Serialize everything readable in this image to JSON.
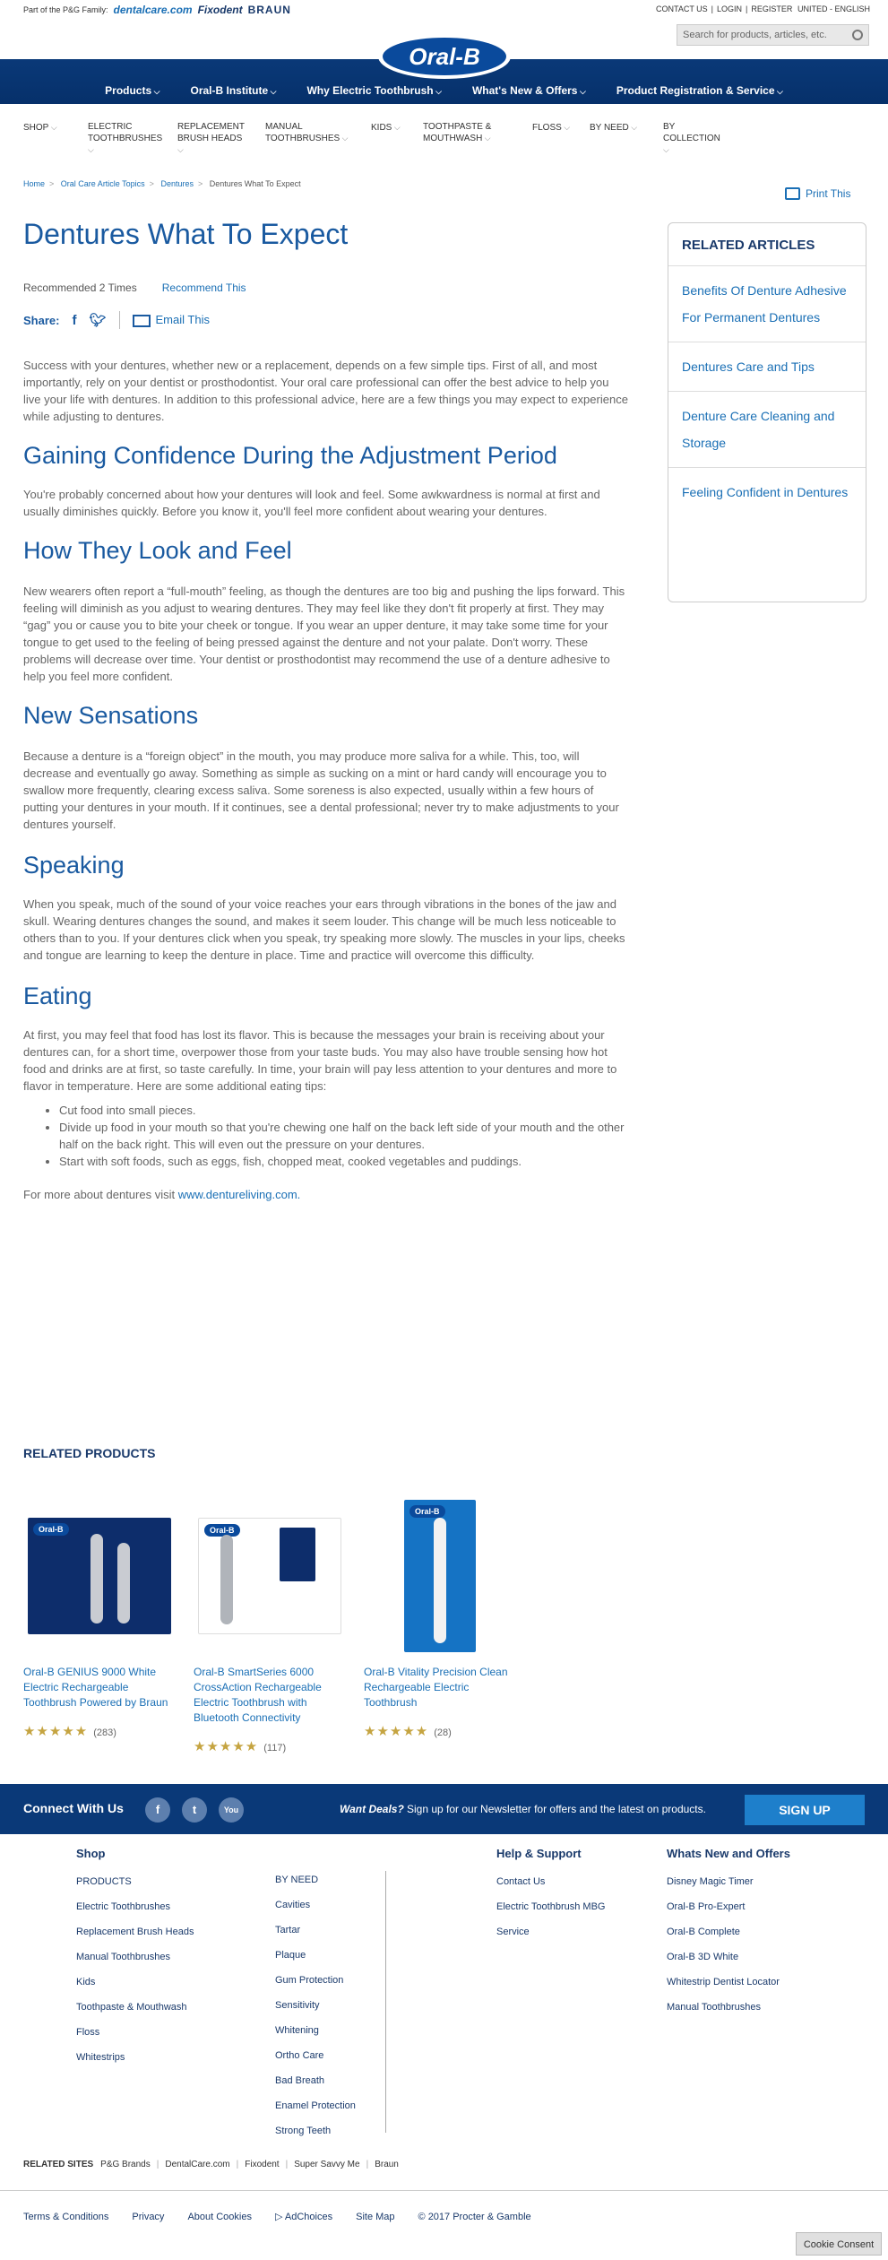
{
  "topbar": {
    "family_label": "Part of the P&G Family:",
    "brands": [
      "dentalcare.com",
      "Fixodent",
      "BRAUN"
    ],
    "contact": "CONTACT US",
    "login": "LOGIN",
    "register": "REGISTER",
    "country": "UNITED - ENGLISH"
  },
  "search": {
    "placeholder": "Search for products, articles, etc."
  },
  "logo": "Oral-B",
  "mainnav": [
    "Products",
    "Oral-B Institute",
    "Why Electric Toothbrush",
    "What's New & Offers",
    "Product Registration & Service"
  ],
  "subnav": [
    "SHOP",
    "ELECTRIC TOOTHBRUSHES",
    "REPLACEMENT BRUSH HEADS",
    "MANUAL TOOTHBRUSHES",
    "KIDS",
    "TOOTHPASTE & MOUTHWASH",
    "FLOSS",
    "BY NEED",
    "BY COLLECTION"
  ],
  "breadcrumb": [
    "Home",
    "Oral Care Article Topics",
    "Dentures",
    "Dentures What To Expect"
  ],
  "print_label": "Print This",
  "title": "Dentures What To Expect",
  "recommended": "Recommended 2 Times",
  "recommend_link": "Recommend This",
  "share_label": "Share:",
  "email_label": "Email This",
  "article": {
    "intro": "Success with your dentures, whether new or a replacement, depends on a few simple tips. First of all, and most importantly, rely on your dentist or prosthodontist. Your oral care professional can offer the best advice to help you live your life with dentures. In addition to this professional advice, here are a few things you may expect to experience while adjusting to dentures.",
    "h_conf": "Gaining Confidence During the Adjustment Period",
    "p_conf": "You're probably concerned about how your dentures will look and feel. Some awkwardness is normal at first and usually diminishes quickly. Before you know it, you'll feel more confident about wearing your dentures.",
    "h_look": "How They Look and Feel",
    "p_look": "New wearers often report a “full-mouth” feeling, as though the dentures are too big and pushing the lips forward. This feeling will diminish as you adjust to wearing dentures. They may feel like they don't fit properly at first. They may “gag” you or cause you to bite your cheek or tongue. If you wear an upper denture, it may take some time for your tongue to get used to the feeling of being pressed against the denture and not your palate. Don't worry. These problems will decrease over time. Your dentist or prosthodontist may recommend the use of a denture adhesive to help you feel more confident.",
    "h_sens": "New Sensations",
    "p_sens": "Because a denture is a “foreign object” in the mouth, you may produce more saliva for a while. This, too, will decrease and eventually go away. Something as simple as sucking on a mint or hard candy will encourage you to swallow more frequently, clearing excess saliva. Some soreness is also expected, usually within a few hours of putting your dentures in your mouth. If it continues, see a dental professional; never try to make adjustments to your dentures yourself.",
    "h_speak": "Speaking",
    "p_speak": "When you speak, much of the sound of your voice reaches your ears through vibrations in the bones of the jaw and skull. Wearing dentures changes the sound, and makes it seem louder. This change will be much less noticeable to others than to you. If your dentures click when you speak, try speaking more slowly. The muscles in your lips, cheeks and tongue are learning to keep the denture in place. Time and practice will overcome this difficulty.",
    "h_eat": "Eating",
    "p_eat": "At first, you may feel that food has lost its flavor. This is because the messages your brain is receiving about your dentures can, for a short time, overpower those from your taste buds. You may also have trouble sensing how hot food and drinks are at first, so taste carefully. In time, your brain will pay less attention to your dentures and more to flavor in temperature. Here are some additional eating tips:",
    "tips": [
      "Cut food into small pieces.",
      "Divide up food in your mouth so that you're chewing one half on the back left side of your mouth and the other half on the back right. This will even out the pressure on your dentures.",
      "Start with soft foods, such as eggs, fish, chopped meat, cooked vegetables and puddings."
    ],
    "more_prefix": "For more about dentures visit ",
    "more_link": "www.dentureliving.com."
  },
  "sidebar": {
    "heading": "RELATED ARTICLES",
    "items": [
      "Benefits Of Denture Adhesive For Permanent Dentures",
      "Dentures Care and Tips",
      "Denture Care Cleaning and Storage",
      "Feeling Confident in Dentures"
    ]
  },
  "related_products": {
    "heading": "RELATED PRODUCTS",
    "items": [
      {
        "name": "Oral-B GENIUS 9000 White Electric Rechargeable Toothbrush Powered by Braun",
        "rating": 5,
        "stars": "★★★★★",
        "count": "(283)"
      },
      {
        "name": "Oral-B SmartSeries 6000 CrossAction Rechargeable Electric Toothbrush with Bluetooth Connectivity",
        "rating": 5,
        "stars": "★★★★★",
        "count": "(117)"
      },
      {
        "name": "Oral-B Vitality Precision Clean Rechargeable Electric Toothbrush",
        "rating": 4.5,
        "stars": "★★★★★",
        "count": "(28)"
      }
    ]
  },
  "connect": {
    "label": "Connect With Us",
    "social": [
      "f",
      "t",
      "You"
    ],
    "deals": "Want Deals?",
    "newsletter": "Sign up for our Newsletter for offers and the latest on products.",
    "signup": "SIGN UP"
  },
  "footer": {
    "shop_heading": "Shop",
    "shop_col1": [
      "PRODUCTS",
      "Electric Toothbrushes",
      "Replacement Brush Heads",
      "Manual Toothbrushes",
      "Kids",
      "Toothpaste & Mouthwash",
      "Floss",
      "Whitestrips"
    ],
    "shop_col2": [
      "BY NEED",
      "Cavities",
      "Tartar",
      "Plaque",
      "Gum Protection",
      "Sensitivity",
      "Whitening",
      "Ortho Care",
      "Bad Breath",
      "Enamel Protection",
      "Strong Teeth"
    ],
    "help_heading": "Help & Support",
    "help": [
      "Contact Us",
      "Electric Toothbrush MBG",
      "Service"
    ],
    "new_heading": "Whats New and Offers",
    "new": [
      "Disney Magic Timer",
      "Oral-B Pro-Expert",
      "Oral-B Complete",
      "Oral-B 3D White",
      "Whitestrip Dentist Locator",
      "Manual Toothbrushes"
    ]
  },
  "related_sites": {
    "label": "RELATED SITES",
    "sites": [
      "P&G Brands",
      "DentalCare.com",
      "Fixodent",
      "Super Savvy Me",
      "Braun"
    ]
  },
  "legal": [
    "Terms & Conditions",
    "Privacy",
    "About Cookies",
    "AdChoices",
    "Site Map",
    "© 2017 Procter & Gamble"
  ],
  "cookie": "Cookie Consent",
  "colors": {
    "brand_blue": "#0a3978",
    "link": "#1a6fb5",
    "heading": "#1a5aa0",
    "star": "#c5a441"
  }
}
